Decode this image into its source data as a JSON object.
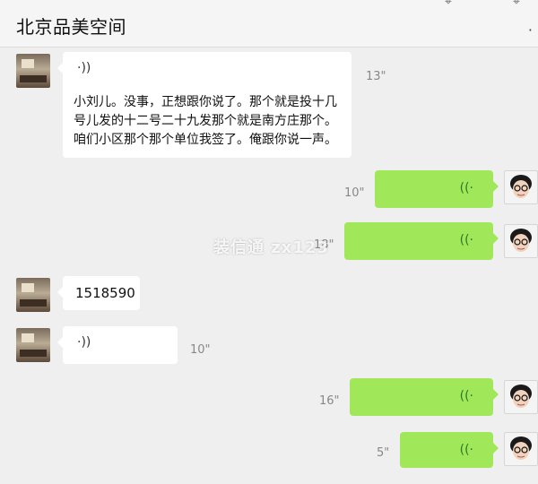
{
  "header": {
    "title": "北京品美空间"
  },
  "watermark": {
    "text": "装信通 zx123"
  },
  "messages": [
    {
      "side": "left",
      "type": "voice",
      "duration": "13\"",
      "transcript": "小刘儿。没事，正想跟你说了。那个就是投十几号儿发的十二号二十九发那个就是南方庄那个。咱们小区那个那个单位我签了。俺跟你说一声。"
    },
    {
      "side": "right",
      "type": "voice",
      "duration": "10\""
    },
    {
      "side": "right",
      "type": "voice",
      "duration": "18\""
    },
    {
      "side": "left",
      "type": "text",
      "text": "1518590"
    },
    {
      "side": "left",
      "type": "voice",
      "duration": "10\""
    },
    {
      "side": "right",
      "type": "voice",
      "duration": "16\""
    },
    {
      "side": "right",
      "type": "voice",
      "duration": "5\""
    }
  ],
  "icons": {
    "voice_wave": "voice-wave-icon"
  }
}
